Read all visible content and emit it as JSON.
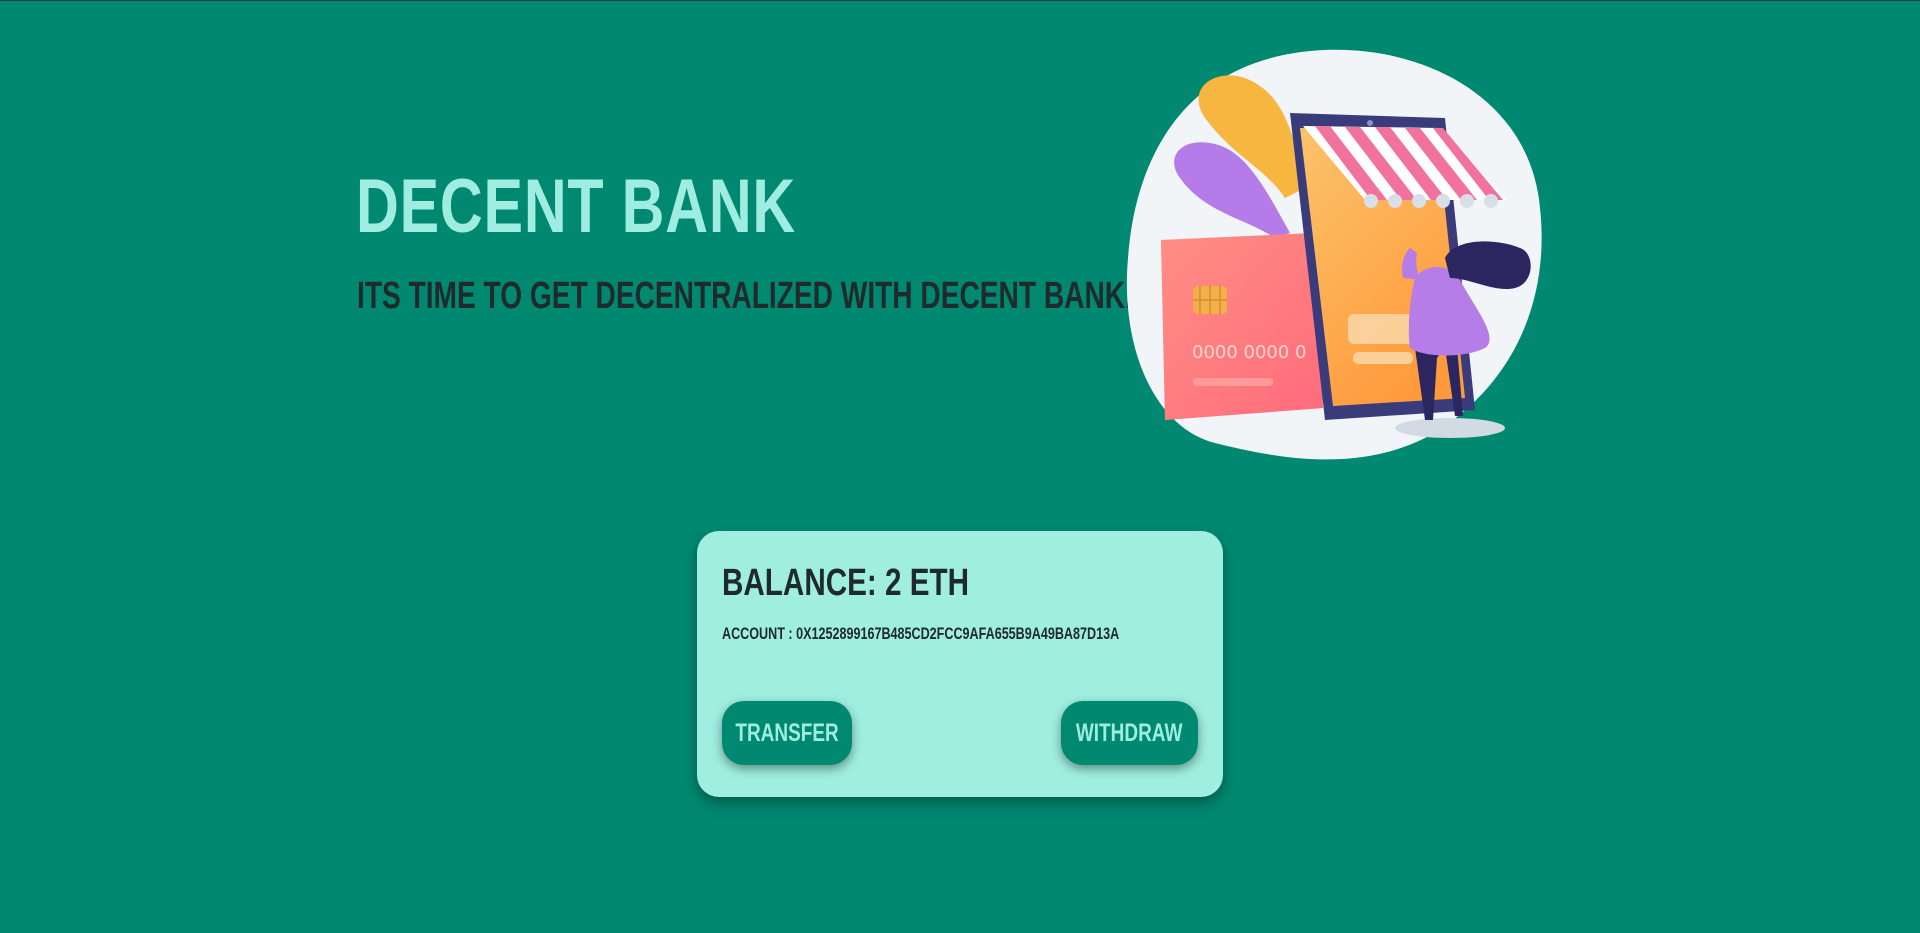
{
  "hero": {
    "title": "Decent Bank",
    "subtitle": "Its time to get decentralized with Decent Bank."
  },
  "illustration": {
    "card_number_text": "0000 0000 0"
  },
  "card": {
    "balance_label": "Balance:",
    "balance_value": "2 ETH",
    "account_label": "Account :",
    "account_value": "0x1252899167b485cD2fcc9afa655B9A49Ba87d13A",
    "transfer_label": "Transfer",
    "withdraw_label": "Withdraw"
  },
  "colors": {
    "background": "#008970",
    "accent_mint": "#9feee0",
    "text_dark": "#1e2a2c"
  }
}
